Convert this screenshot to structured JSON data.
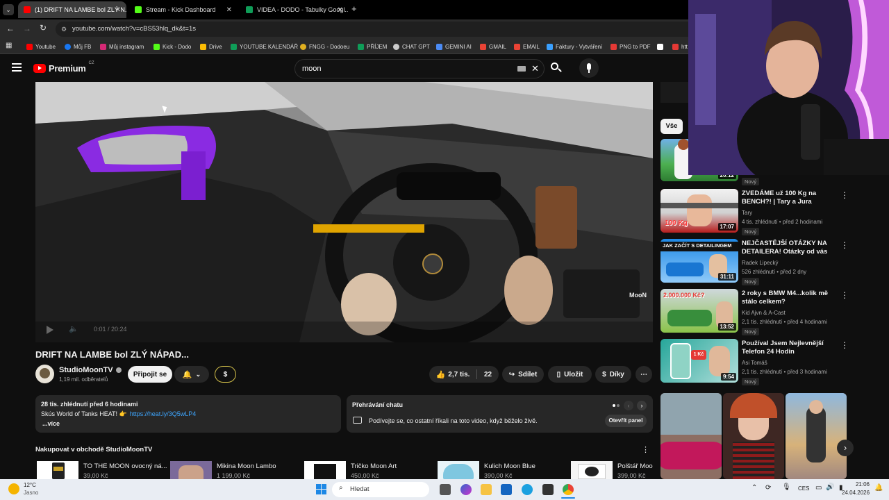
{
  "tabs": [
    {
      "label": "(1) DRIFT NA LAMBE bol ZLÝ N...",
      "color": "#ff0000"
    },
    {
      "label": "Stream - Kick Dashboard",
      "color": "#53fc18"
    },
    {
      "label": "VIDEA - DODO - Tabulky Googl...",
      "color": "#0f9d58"
    }
  ],
  "url": "youtube.com/watch?v=cBS53hlq_dk&t=1s",
  "bookmarks": [
    {
      "label": "Youtube",
      "color": "#ff0000"
    },
    {
      "label": "Můj FB",
      "color": "#1877f2"
    },
    {
      "label": "Můj instagram",
      "color": "#d62976"
    },
    {
      "label": "Kick - Dodo",
      "color": "#53fc18"
    },
    {
      "label": "Drive",
      "color": "#fbbc04"
    },
    {
      "label": "YOUTUBE KALENDÁŘ",
      "color": "#0f9d58"
    },
    {
      "label": "FNGG - Dodoeu",
      "color": "#e0b020"
    },
    {
      "label": "PŘÍJEM",
      "color": "#0f9d58"
    },
    {
      "label": "CHAT GPT",
      "color": "#cccccc"
    },
    {
      "label": "GEMINI AI",
      "color": "#4b8bf5"
    },
    {
      "label": "GMAIL",
      "color": "#ea4335"
    },
    {
      "label": "EMAIL",
      "color": "#ea4335"
    },
    {
      "label": "Faktury - Vytváření",
      "color": "#3aa0ff"
    },
    {
      "label": "PNG to PDF",
      "color": "#e53935"
    },
    {
      "label": "htt",
      "color": "#e53935"
    }
  ],
  "yt": {
    "logo": "Premium",
    "logo_country": "CZ",
    "search_query": "moon"
  },
  "video": {
    "title": "DRIFT NA LAMBE bol ZLÝ NÁPAD...",
    "time": "0:01 / 20:24",
    "watermark": "MooN"
  },
  "channel": {
    "name": "StudioMoonTV",
    "subs": "1,19 mil. odběratelů",
    "join": "Připojit se"
  },
  "actions": {
    "likes": "2,7 tis.",
    "dislikes": "22",
    "share": "Sdílet",
    "save": "Uložit",
    "thanks": "Díky"
  },
  "description": {
    "stats": "28 tis. zhlédnutí  před 6 hodinami",
    "line": "Skús World of Tanks HEAT! 👉",
    "link": "https://heat.ly/3Q5wLP4",
    "more": "...více"
  },
  "chat": {
    "title": "Přehrávání chatu",
    "text": "Podívejte se, co ostatní říkali na toto video, když běželo živě.",
    "open": "Otevřít panel"
  },
  "shop": {
    "title": "Nakupovat v obchodě StudioMoonTV",
    "items": [
      {
        "title": "TO THE MOON ovocný ná...",
        "price": "39,00 Kč"
      },
      {
        "title": "Mikina Moon Lambo",
        "price": "1 199,00 Kč"
      },
      {
        "title": "Tričko Moon Art",
        "price": "450,00 Kč"
      },
      {
        "title": "Kulich Moon Blue",
        "price": "390,00 Kč"
      },
      {
        "title": "Polštář Moo",
        "price": "399,00 Kč"
      }
    ]
  },
  "sidebar": {
    "chip": "Vše",
    "first_duration": "20:12",
    "first_badge": "Nový",
    "videos": [
      {
        "title": "ZVEDÁME už 100 Kg na BENCH?! | Tary a Jura",
        "channel": "Tary",
        "meta": "4 tis. zhlédnutí • před 2 hodinami",
        "badge": "Nový",
        "duration": "17:07",
        "thumb_text": "100 Kg",
        "color": "#c62828"
      },
      {
        "title": "NEJČASTĚJŠÍ OTÁZKY NA DETAILERA! Otázky od vás",
        "channel": "Radek Lipecký",
        "meta": "526 zhlédnutí • před 2 dny",
        "badge": "Nový",
        "duration": "31:11",
        "thumb_text": "JAK ZAČÍT S DETAILINGEM",
        "color": "#1565c0"
      },
      {
        "title": "2 roky s BMW M4...kolik mě stálo celkem?",
        "channel": "Kid Ajvn & A-Cast",
        "meta": "2,1 tis. zhlédnutí • před 4 hodinami",
        "badge": "Nový",
        "duration": "13:52",
        "thumb_text": "2.000.000 Kč?",
        "color": "#2e7d32"
      },
      {
        "title": "Používal Jsem Nejlevnější Telefon 24 Hodin",
        "channel": "Asi Tomáš",
        "meta": "2,1 tis. zhlédnutí • před 3 hodinami",
        "badge": "Nový",
        "duration": "9:54",
        "thumb_text": "1 Kč",
        "color": "#00897b"
      }
    ]
  },
  "taskbar": {
    "weather_temp": "12°C",
    "weather_text": "Jasno",
    "search": "Hledat",
    "lang": "CES",
    "time": "21:06",
    "date": "24.04.2026"
  }
}
